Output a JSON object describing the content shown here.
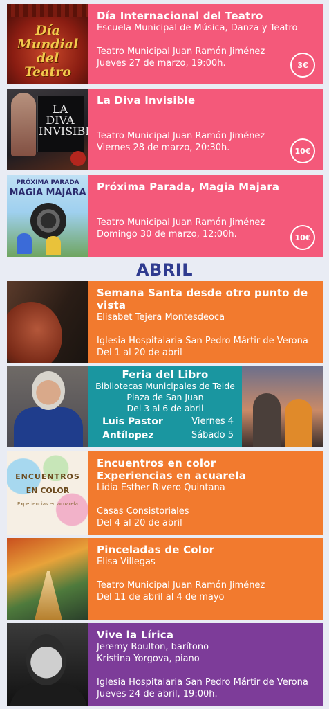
{
  "march_events": [
    {
      "title": "Día Internacional del Teatro",
      "subtitle": "Escuela Municipal de Música, Danza y Teatro",
      "venue": "Teatro Municipal Juan Ramón Jiménez",
      "date": "Jueves 27 de marzo, 19:00h.",
      "price": "3€",
      "image_text": "Día Mundial del Teatro"
    },
    {
      "title": "La Diva Invisible",
      "venue": "Teatro Municipal Juan Ramón Jiménez",
      "date": "Viernes 28 de marzo, 20:30h.",
      "price": "10€",
      "image_text": "LA DIVA INVISIBLE"
    },
    {
      "title": "Próxima Parada, Magia Majara",
      "venue": "Teatro Municipal Juan Ramón Jiménez",
      "date": "Domingo 30 de marzo, 12:00h.",
      "price": "10€",
      "image_text_top": "PRÓXIMA    PARADA",
      "image_text_main": "MAGIA MAJARA"
    }
  ],
  "month_header": "ABRIL",
  "april_events": [
    {
      "title_line1": "Semana Santa desde otro punto de",
      "title_line2": "vista",
      "subtitle": "Elisabet Tejera Montesdeoca",
      "venue": "Iglesia Hospitalaria San Pedro Mártir de Verona",
      "date": "Del 1 al 20 de abril"
    },
    {
      "title": "Feria del Libro",
      "line1": "Bibliotecas Municipales de Telde",
      "line2": "Plaza de San Juan",
      "line3": "Del 3 al 6 de  abril",
      "guest1_name": "Luis Pastor",
      "guest1_day": "Viernes 4",
      "guest2_name": "Antílopez",
      "guest2_day": "Sábado 5"
    },
    {
      "title_line1": "Encuentros en color",
      "title_line2": "Experiencias en acuarela",
      "subtitle": "Lidia Esther Rivero Quintana",
      "venue": "Casas Consistoriales",
      "date": "Del 4 al 20 de abril",
      "image_title1": "ENCUENTROS",
      "image_title2": "EN COLOR",
      "image_sub": "Experiencias en acuarela"
    },
    {
      "title": "Pinceladas de Color",
      "subtitle": "Elisa Villegas",
      "venue": "Teatro Municipal Juan Ramón Jiménez",
      "date": "Del 11 de abril al 4 de mayo"
    },
    {
      "title": "Vive la Lírica",
      "performer1": "Jeremy Boulton, barítono",
      "performer2": "Kristina Yorgova, piano",
      "venue": "Iglesia Hospitalaria San Pedro Mártir de Verona",
      "date": "Jueves 24 de abril, 19:00h."
    }
  ],
  "colors": {
    "pink": "#f4597a",
    "orange": "#f27a2e",
    "purple": "#7d3c99",
    "teal": "#1a96a0",
    "header": "#2f3b8f"
  }
}
